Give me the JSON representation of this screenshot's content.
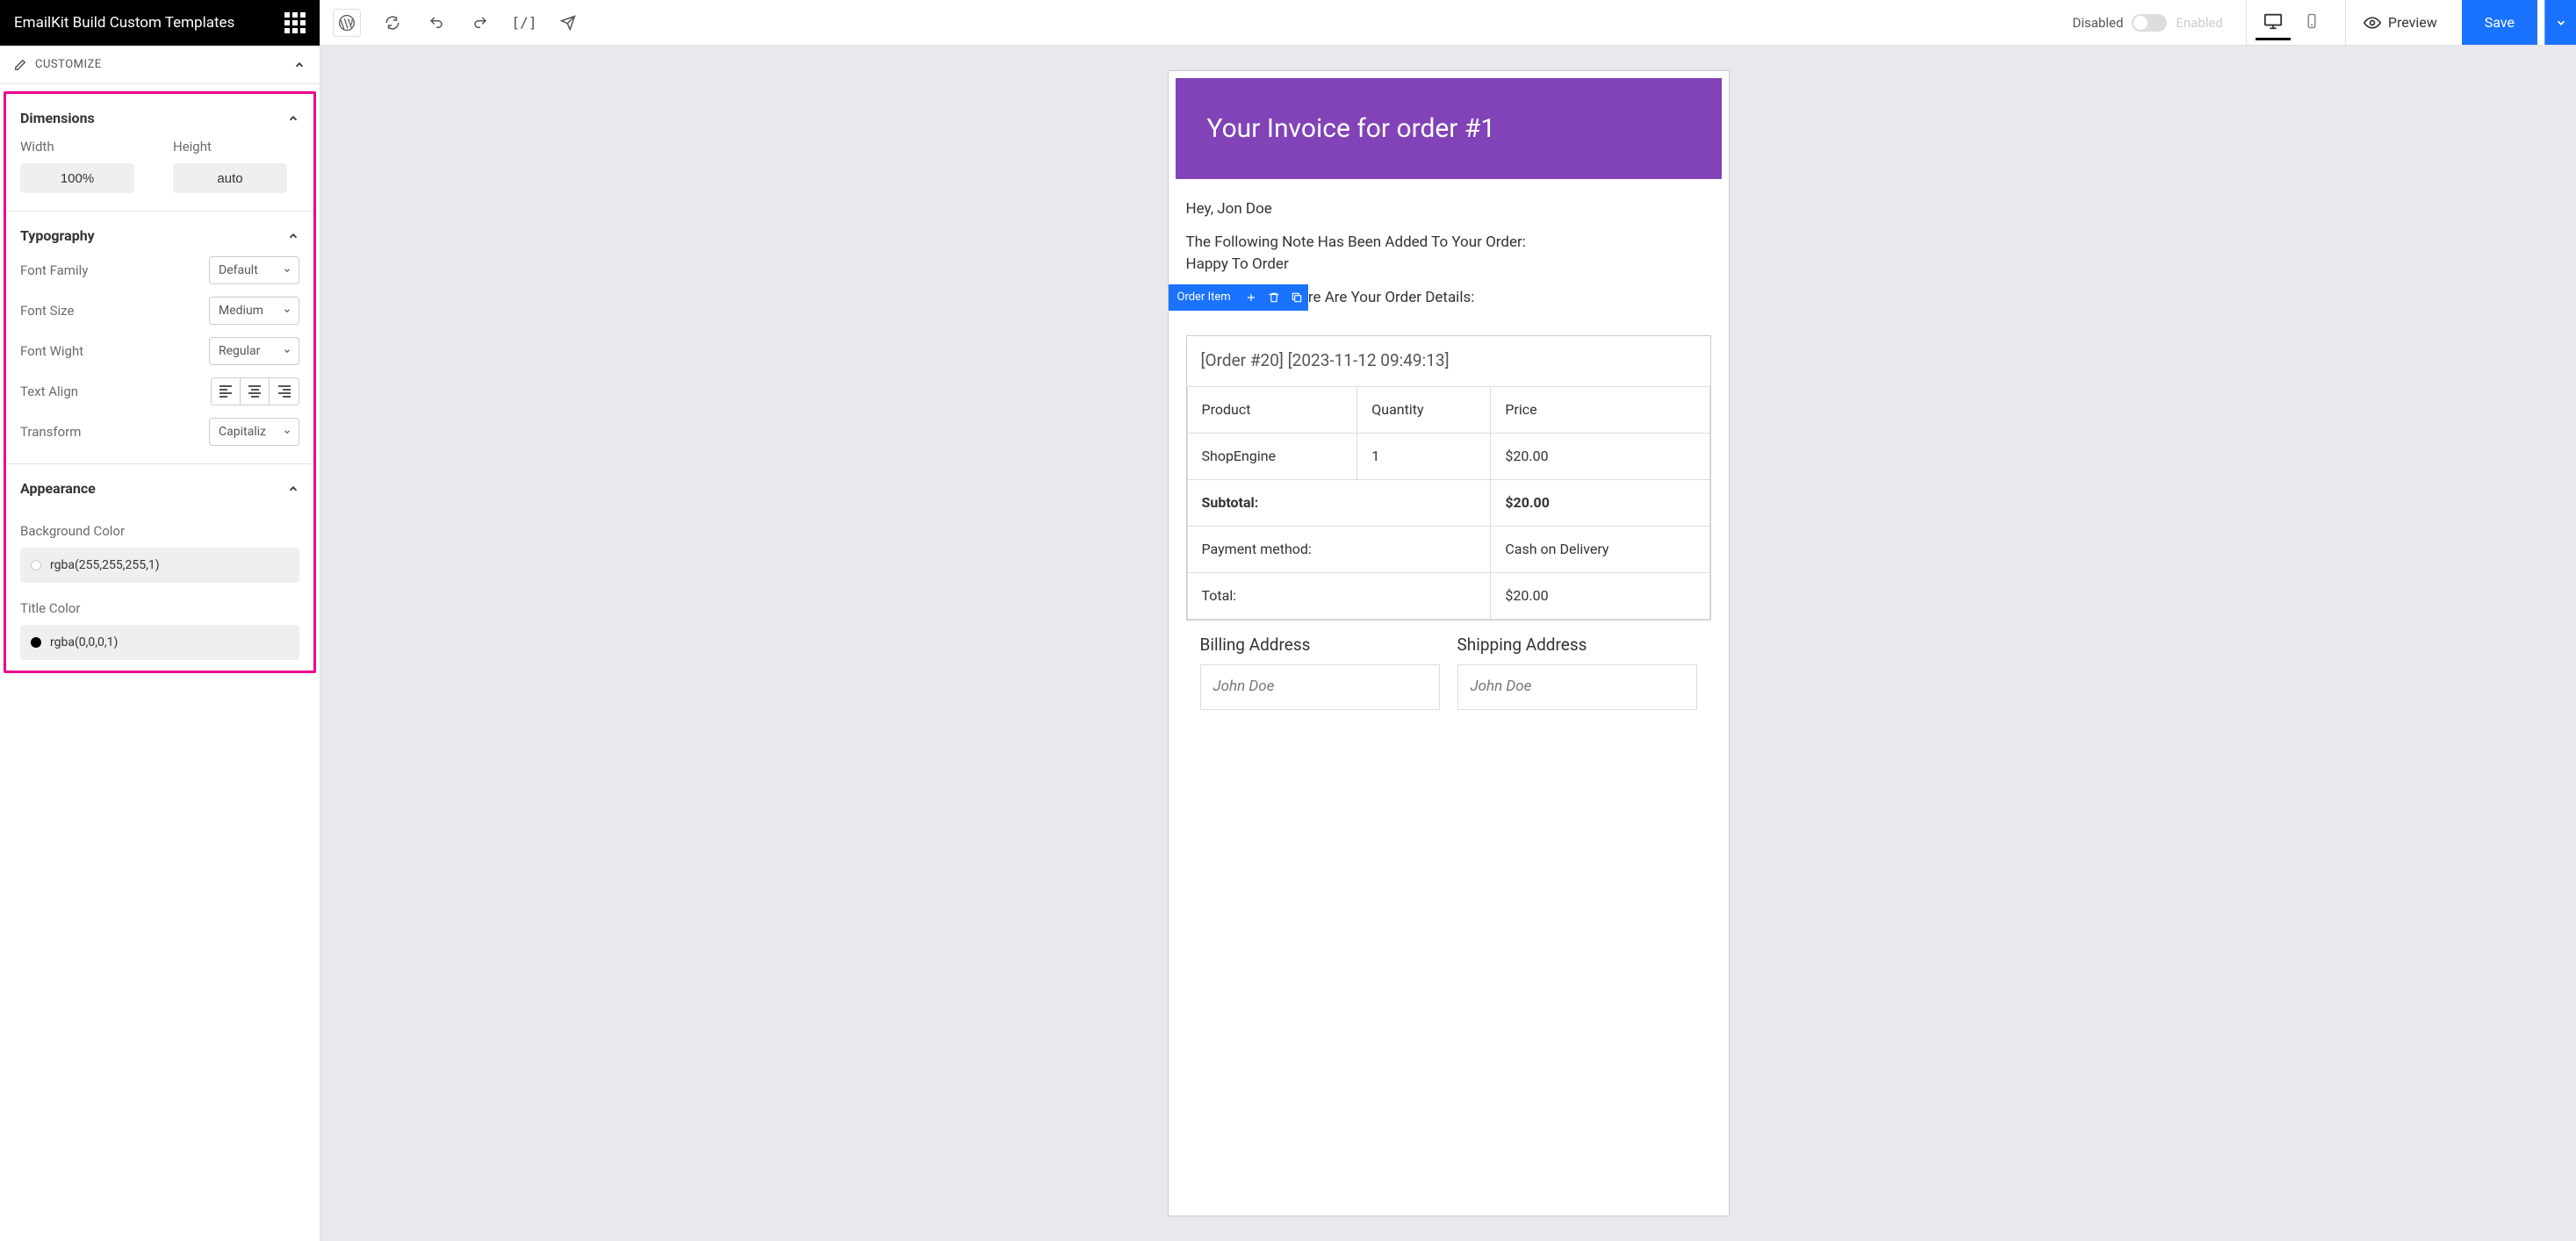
{
  "sidebar": {
    "title": "EmailKit Build Custom Templates",
    "customize_label": "CUSTOMIZE",
    "panels": {
      "dimensions": {
        "title": "Dimensions",
        "width_label": "Width",
        "width_value": "100%",
        "height_label": "Height",
        "height_value": "auto"
      },
      "typography": {
        "title": "Typography",
        "font_family_label": "Font Family",
        "font_family_value": "Default",
        "font_size_label": "Font Size",
        "font_size_value": "Medium",
        "font_weight_label": "Font Wight",
        "font_weight_value": "Regular",
        "text_align_label": "Text Align",
        "transform_label": "Transform",
        "transform_value": "Capitaliz"
      },
      "appearance": {
        "title": "Appearance",
        "bg_color_label": "Background Color",
        "bg_color_value": "rgba(255,255,255,1)",
        "bg_swatch": "#ffffff",
        "title_color_label": "Title Color",
        "title_color_value": "rgba(0,0,0,1)",
        "title_swatch": "#000000"
      }
    }
  },
  "topbar": {
    "disabled_label": "Disabled",
    "enabled_label": "Enabled",
    "preview_label": "Preview",
    "save_label": "Save"
  },
  "email": {
    "header": "Your Invoice for order #1",
    "greeting": "Hey, Jon Doe",
    "note_line1": "The Following Note Has Been Added To Your Order:",
    "note_line2": "Happy To Order",
    "reminder": "As A Reminder, Here Are Your Order Details:",
    "block_toolbar_label": "Order Item",
    "order_title": "[Order #20] [2023-11-12 09:49:13]",
    "table": {
      "headers": {
        "product": "Product",
        "quantity": "Quantity",
        "price": "Price"
      },
      "rows": [
        {
          "product": "ShopEngine",
          "quantity": "1",
          "price": "$20.00"
        }
      ],
      "subtotal_label": "Subtotal:",
      "subtotal_value": "$20.00",
      "payment_label": "Payment method:",
      "payment_value": "Cash on Delivery",
      "total_label": "Total:",
      "total_value": "$20.00"
    },
    "billing_head": "Billing Address",
    "shipping_head": "Shipping Address",
    "addr_name": "John Doe"
  }
}
